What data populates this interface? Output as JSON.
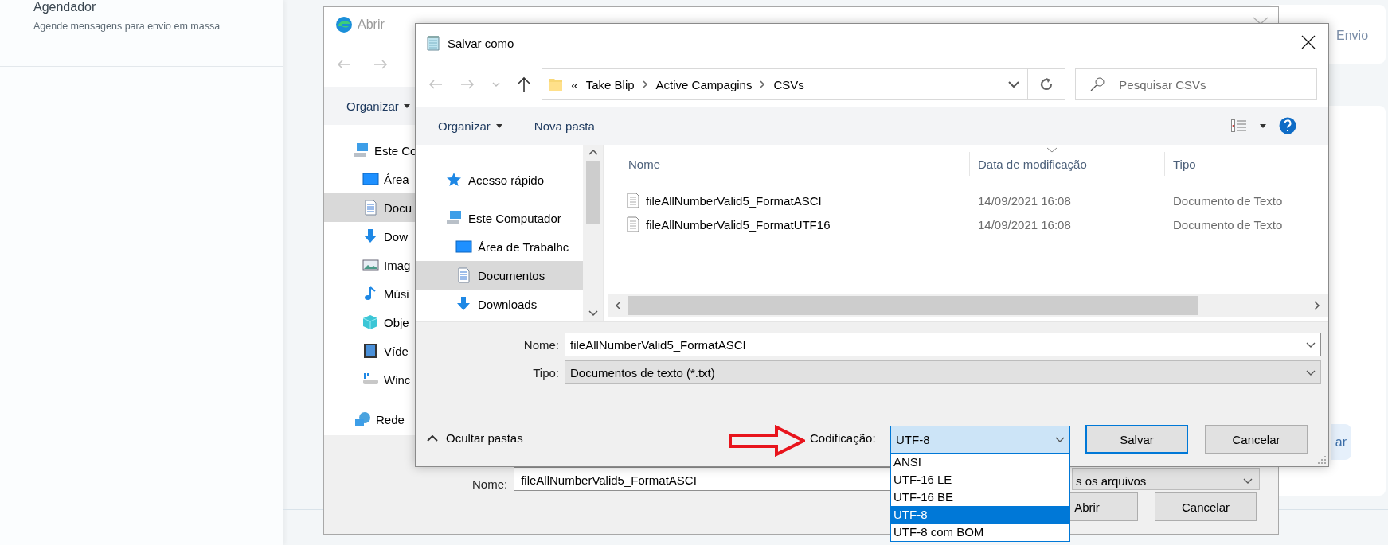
{
  "background_page": {
    "title": "Agendador",
    "subtitle": "Agende mensagens para envio em massa",
    "tab_label": "Envio",
    "button_label": "ar"
  },
  "open_dialog": {
    "title": "Abrir",
    "organize": "Organizar",
    "nav_items": [
      {
        "label": "Este Co",
        "kind": "computer",
        "selected": false,
        "children": [
          {
            "label": "Área",
            "kind": "desktop",
            "selected": false
          },
          {
            "label": "Docu",
            "kind": "documents",
            "selected": true
          },
          {
            "label": "Dow",
            "kind": "downloads",
            "selected": false
          },
          {
            "label": "Imag",
            "kind": "pictures",
            "selected": false
          },
          {
            "label": "Músi",
            "kind": "music",
            "selected": false
          },
          {
            "label": "Obje",
            "kind": "objects",
            "selected": false
          },
          {
            "label": "Víde",
            "kind": "videos",
            "selected": false
          },
          {
            "label": "Winc",
            "kind": "drive",
            "selected": false
          }
        ]
      },
      {
        "label": "Rede",
        "kind": "network",
        "selected": false
      }
    ],
    "name_label": "Nome:",
    "name_value": "fileAllNumberValid5_FormatASCI",
    "type_value": "s os arquivos",
    "buttons": [
      "Abrir",
      "Cancelar"
    ]
  },
  "save_dialog": {
    "title": "Salvar como",
    "breadcrumb_overflow": "«",
    "breadcrumb": [
      "Take Blip",
      "Active Campagins",
      "CSVs"
    ],
    "search": {
      "placeholder": "Pesquisar CSVs"
    },
    "organize": "Organizar",
    "new_folder": "Nova pasta",
    "nav_items": [
      {
        "label": "Acesso rápido",
        "kind": "quick",
        "selected": false
      },
      {
        "label": "Este Computador",
        "kind": "computer",
        "selected": false,
        "children": [
          {
            "label": "Área de Trabalhc",
            "kind": "desktop",
            "selected": false
          },
          {
            "label": "Documentos",
            "kind": "documents",
            "selected": true
          },
          {
            "label": "Downloads",
            "kind": "downloads",
            "selected": false
          }
        ]
      }
    ],
    "columns": [
      "Nome",
      "Data de modificação",
      "Tipo"
    ],
    "files": [
      {
        "name": "fileAllNumberValid5_FormatASCI",
        "modified": "14/09/2021 16:08",
        "type": "Documento de Texto"
      },
      {
        "name": "fileAllNumberValid5_FormatUTF16",
        "modified": "14/09/2021 16:08",
        "type": "Documento de Texto"
      }
    ],
    "name_label": "Nome:",
    "name_value": "fileAllNumberValid5_FormatASCI",
    "type_label": "Tipo:",
    "type_value": "Documentos de texto (*.txt)",
    "hide_folders": "Ocultar pastas",
    "encoding_label": "Codificação:",
    "encoding_value": "UTF-8",
    "encoding_options": [
      {
        "label": "ANSI",
        "selected": false
      },
      {
        "label": "UTF-16 LE",
        "selected": false
      },
      {
        "label": "UTF-16 BE",
        "selected": false
      },
      {
        "label": "UTF-8",
        "selected": true
      },
      {
        "label": "UTF-8 com BOM",
        "selected": false
      }
    ],
    "buttons": [
      "Salvar",
      "Cancelar"
    ]
  }
}
